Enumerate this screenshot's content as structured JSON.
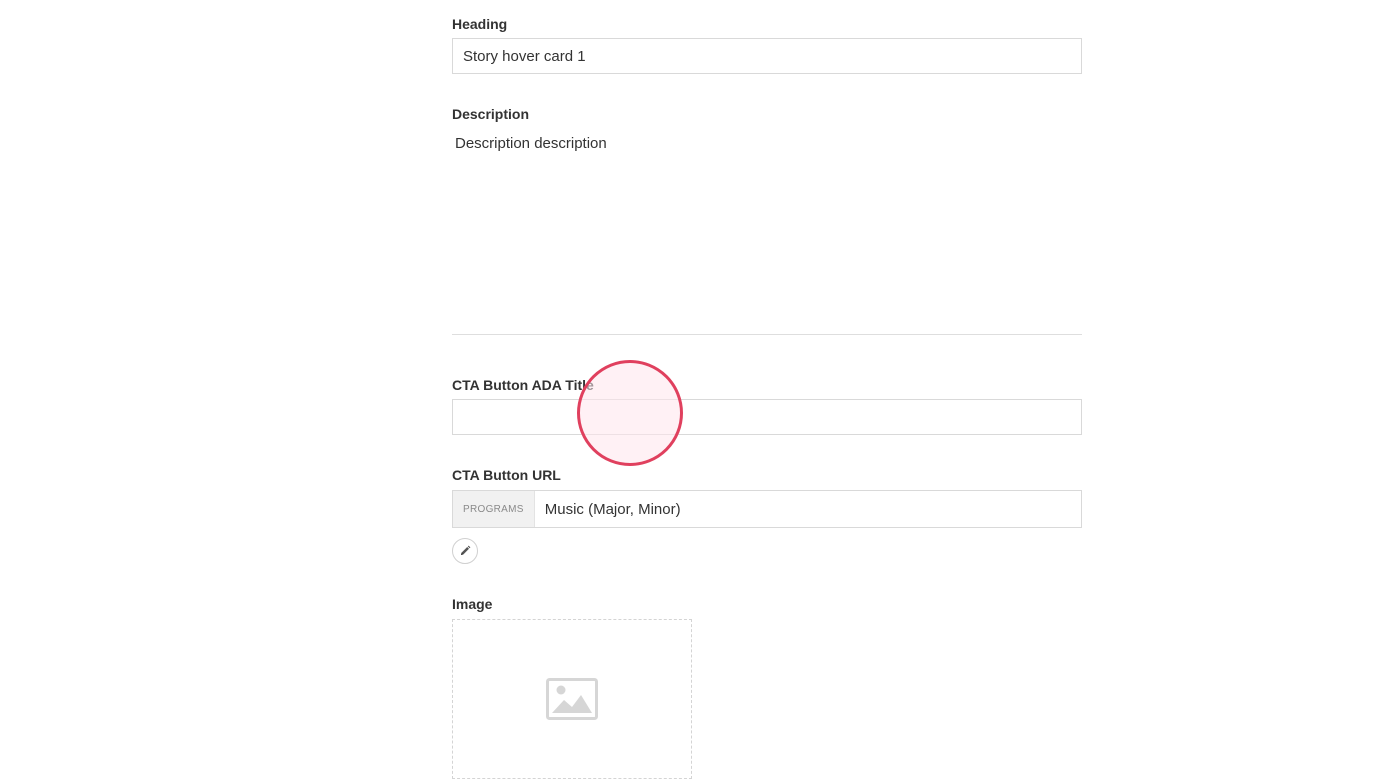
{
  "form": {
    "heading": {
      "label": "Heading",
      "value": "Story hover card 1"
    },
    "description": {
      "label": "Description",
      "value": "Description description"
    },
    "cta_title": {
      "label": "CTA Button ADA Title",
      "value": ""
    },
    "cta_url": {
      "label": "CTA Button URL",
      "prefix": "PROGRAMS",
      "value": "Music (Major, Minor)",
      "edit_icon": "pencil-icon"
    },
    "image": {
      "label": "Image",
      "placeholder_icon": "image-placeholder-icon"
    }
  },
  "cursor": {
    "color": "#e0405e"
  }
}
